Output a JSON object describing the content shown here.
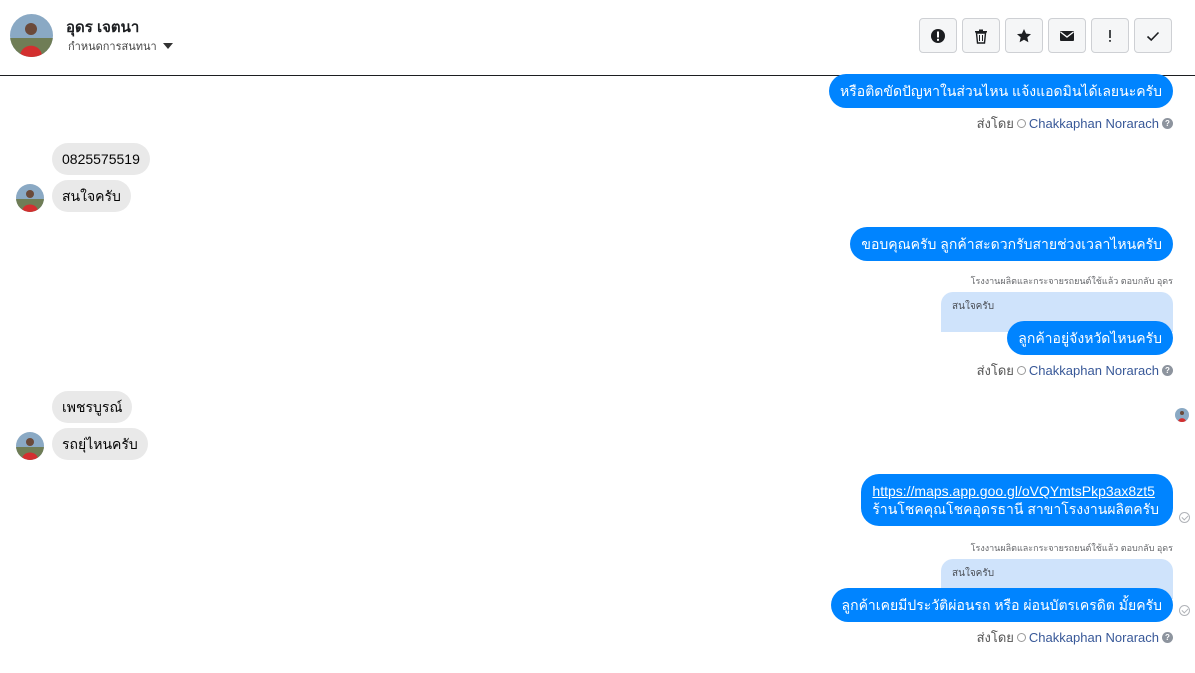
{
  "header": {
    "contact_name": "อุดร เจตนา",
    "assign_label": "กำหนดการสนทนา",
    "actions": [
      {
        "name": "spam-button",
        "icon": "alert-circle-icon"
      },
      {
        "name": "delete-button",
        "icon": "trash-icon"
      },
      {
        "name": "star-button",
        "icon": "star-icon"
      },
      {
        "name": "mark-unread-button",
        "icon": "envelope-icon"
      },
      {
        "name": "follow-up-button",
        "icon": "exclamation-icon"
      },
      {
        "name": "mark-done-button",
        "icon": "check-icon"
      }
    ]
  },
  "messages": {
    "m1": "หรือติดขัดปัญหาในส่วนไหน แจ้งแอดมินได้เลยนะครับ",
    "m2": "0825575519",
    "m3": "สนใจครับ",
    "m4": "ขอบคุณครับ ลูกค้าสะดวกรับสายช่วงเวลาไหนครับ",
    "reply_note_1": "โรงงานผลิตและกระจายรถยนต์ใช้แล้ว ตอบกลับ อุดร",
    "quote_1": "สนใจครับ",
    "m5": "ลูกค้าอยู่จังหวัดไหนครับ",
    "m6": "เพชรบูรณ์",
    "m7": "รถยุ่ไหนครับ",
    "m8_link": "https://maps.app.goo.gl/oVQYmtsPkp3ax8zt5",
    "m8_text": "ร้านโชคคุณโชคอุดรธานี สาขาโรงงานผลิตครับ",
    "reply_note_2": "โรงงานผลิตและกระจายรถยนต์ใช้แล้ว ตอบกลับ อุดร",
    "quote_2": "สนใจครับ",
    "m9": "ลูกค้าเคยมีประวัติผ่อนรถ หรือ ผ่อนบัตรเครดิต มั้ยครับ"
  },
  "sent_by": {
    "label": "ส่งโดย",
    "agent": "Chakkaphan Norarach",
    "help": "?"
  },
  "colors": {
    "outgoing_bubble": "#0084ff",
    "incoming_bubble": "#e9e9e9",
    "quote_bubble": "#cfe3fb",
    "agent_link": "#385898"
  }
}
